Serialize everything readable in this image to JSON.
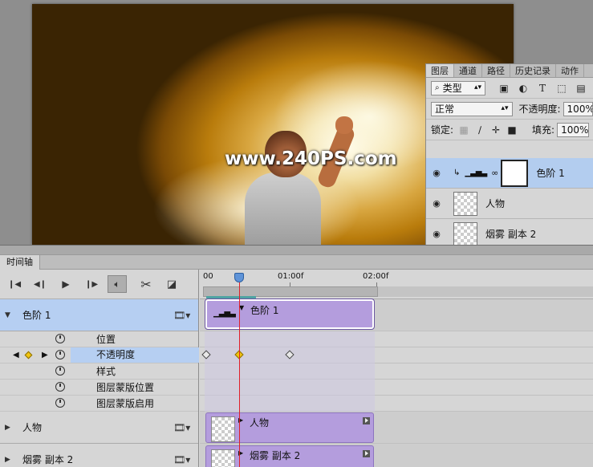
{
  "canvas": {
    "watermark": "www.240PS.com"
  },
  "layers_panel": {
    "tabs": [
      "图层",
      "通道",
      "路径",
      "历史记录",
      "动作"
    ],
    "active_tab": 0,
    "filter_kind": "类型",
    "blend_mode": "正常",
    "opacity_label": "不透明度:",
    "opacity_value": "100%",
    "lock_label": "锁定:",
    "fill_label": "填充:",
    "fill_value": "100%",
    "layers": [
      {
        "name": "色阶 1",
        "selected": true
      },
      {
        "name": "人物",
        "selected": false
      },
      {
        "name": "烟雾 副本 2",
        "selected": false
      }
    ]
  },
  "timeline": {
    "tab_label": "时间轴",
    "ruler": [
      "00",
      "01:00f",
      "02:00f"
    ],
    "groups": [
      {
        "name": "色阶 1",
        "clip_label": "色阶 1"
      },
      {
        "name": "人物",
        "clip_label": "人物"
      },
      {
        "name": "烟雾 副本 2",
        "clip_label": "烟雾 副本 2"
      }
    ],
    "properties": [
      "位置",
      "不透明度",
      "样式",
      "图层蒙版位置",
      "图层蒙版启用"
    ],
    "active_property": 1
  },
  "colors": {
    "accent": "#b3cdef",
    "clip": "#b49ddd",
    "playhead": "#e0202a",
    "keyframe": "#f1c40f"
  }
}
